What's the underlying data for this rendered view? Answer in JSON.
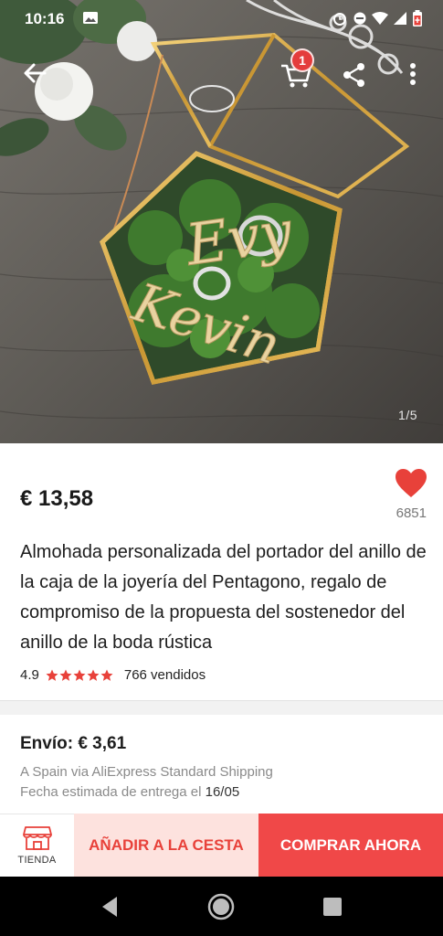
{
  "status_bar": {
    "time": "10:16"
  },
  "header": {
    "cart_count": "1",
    "image_counter": "1/5"
  },
  "image_text": {
    "name_top": "Evy",
    "name_bottom": "Kevin"
  },
  "product": {
    "price": "€ 13,58",
    "wishlist_count": "6851",
    "title": "Almohada personalizada del portador del anillo de la caja de la joyería del Pentagono, regalo de compromiso de la propuesta del sostenedor del anillo de la boda rústica",
    "rating": "4.9",
    "stars": 5,
    "sold": "766 vendidos"
  },
  "shipping": {
    "cost": "Envío: € 3,61",
    "route": "A Spain via AliExpress Standard Shipping",
    "date_label": "Fecha estimada de entrega el ",
    "date": "16/05"
  },
  "actions": {
    "store_label": "TIENDA",
    "add_to_cart": "AÑADIR A LA CESTA",
    "buy_now": "COMPRAR AHORA"
  },
  "colors": {
    "accent": "#f04848",
    "accent_light": "#fde2de",
    "star": "#e8413a",
    "badge": "#e43c3c"
  }
}
